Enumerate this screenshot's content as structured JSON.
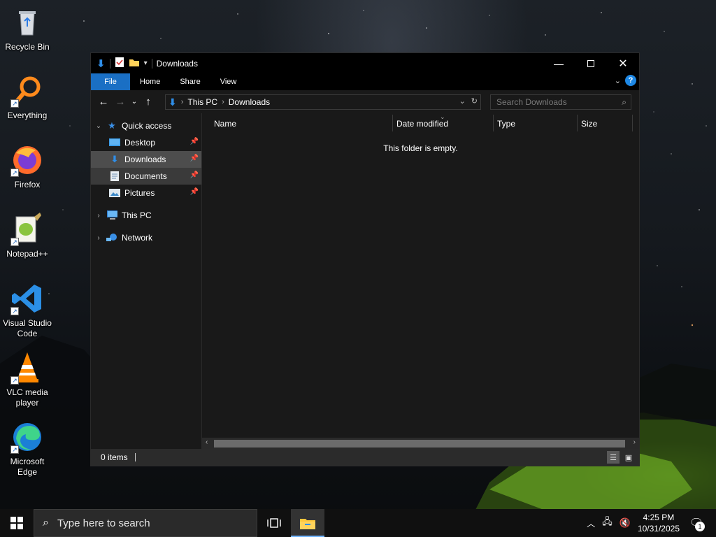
{
  "desktop": {
    "icons": [
      {
        "label": "Recycle Bin",
        "icon": "recycle-bin-icon"
      },
      {
        "label": "Everything",
        "icon": "everything-search-icon"
      },
      {
        "label": "Firefox",
        "icon": "firefox-icon"
      },
      {
        "label": "Notepad++",
        "icon": "notepadpp-icon"
      },
      {
        "label": "Visual Studio Code",
        "icon": "vscode-icon"
      },
      {
        "label": "VLC media player",
        "icon": "vlc-icon"
      },
      {
        "label": "Microsoft Edge",
        "icon": "edge-icon"
      }
    ]
  },
  "window": {
    "title": "Downloads",
    "ribbon_tabs": {
      "file": "File",
      "home": "Home",
      "share": "Share",
      "view": "View"
    },
    "address": {
      "crumb1": "This PC",
      "crumb2": "Downloads"
    },
    "search_placeholder": "Search Downloads",
    "nav": {
      "quick_access": "Quick access",
      "desktop": "Desktop",
      "downloads": "Downloads",
      "documents": "Documents",
      "pictures": "Pictures",
      "this_pc": "This PC",
      "network": "Network"
    },
    "columns": {
      "name": "Name",
      "date_modified": "Date modified",
      "type": "Type",
      "size": "Size"
    },
    "empty_message": "This folder is empty.",
    "status": {
      "items": "0 items"
    }
  },
  "taskbar": {
    "search_placeholder": "Type here to search",
    "time": "4:25 PM",
    "date": "10/31/2025",
    "notification_count": "1"
  },
  "colors": {
    "accent": "#1a6fc4",
    "window_bg": "#191919",
    "titlebar_bg": "#000000",
    "selected_nav": "#4d4d4d",
    "taskbar_bg": "#101010"
  }
}
